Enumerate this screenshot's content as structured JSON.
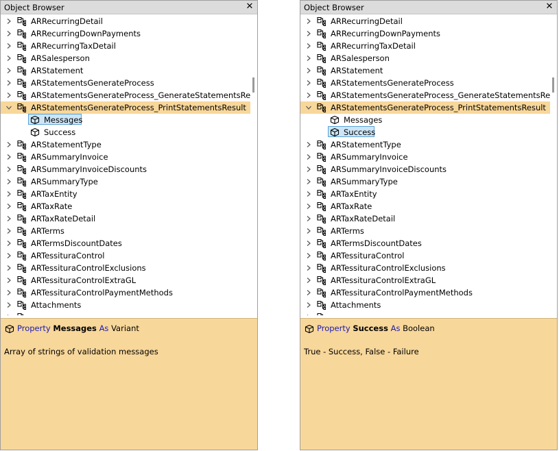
{
  "panel_title": "Object Browser",
  "close_glyph": "✕",
  "items_before": [
    "ARRecurringDetail",
    "ARRecurringDownPayments",
    "ARRecurringTaxDetail",
    "ARSalesperson",
    "ARStatement",
    "ARStatementsGenerateProcess",
    "ARStatementsGenerateProcess_GenerateStatementsResult"
  ],
  "expanded_item": "ARStatementsGenerateProcess_PrintStatementsResult",
  "children": [
    "Messages",
    "Success"
  ],
  "items_after": [
    "ARStatementType",
    "ARSummaryInvoice",
    "ARSummaryInvoiceDiscounts",
    "ARSummaryType",
    "ARTaxEntity",
    "ARTaxRate",
    "ARTaxRateDetail",
    "ARTerms",
    "ARTermsDiscountDates",
    "ARTessituraControl",
    "ARTessituraControlExclusions",
    "ARTessituraControlExtraGL",
    "ARTessituraControlPaymentMethods",
    "Attachments"
  ],
  "icons": {
    "collapsed": "chevron-right-icon",
    "expanded": "chevron-down-icon",
    "class": "class-icon",
    "property": "property-cube-icon"
  },
  "colors": {
    "selection": "#f8d79a",
    "highlight_fill": "#cde6f7",
    "highlight_border": "#5aa0d8",
    "keyword": "#1b1bb0"
  },
  "panels": [
    {
      "selected_child": 0,
      "desc": {
        "kw_property": "Property",
        "name": "Messages",
        "kw_as": "As",
        "type": "Variant",
        "text": "Array of strings of validation messages"
      }
    },
    {
      "selected_child": 1,
      "desc": {
        "kw_property": "Property",
        "name": "Success",
        "kw_as": "As",
        "type": "Boolean",
        "text": "True - Success, False - Failure"
      }
    }
  ]
}
